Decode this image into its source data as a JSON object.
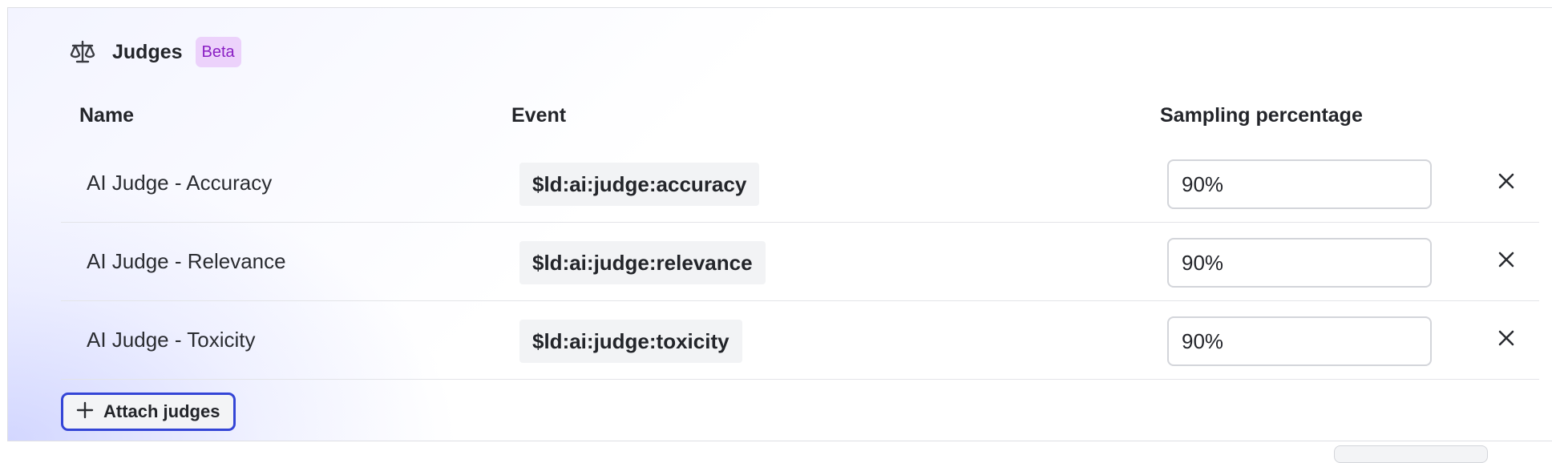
{
  "section": {
    "title": "Judges",
    "badge": "Beta",
    "icon": "scale-icon"
  },
  "table": {
    "columns": {
      "name": "Name",
      "event": "Event",
      "sampling": "Sampling percentage"
    },
    "rows": [
      {
        "name": "AI Judge - Accuracy",
        "event": "$ld:ai:judge:accuracy",
        "sampling": "90%"
      },
      {
        "name": "AI Judge - Relevance",
        "event": "$ld:ai:judge:relevance",
        "sampling": "90%"
      },
      {
        "name": "AI Judge - Toxicity",
        "event": "$ld:ai:judge:toxicity",
        "sampling": "90%"
      }
    ]
  },
  "actions": {
    "attach_label": "Attach judges"
  },
  "colors": {
    "accent": "#3445d6",
    "badge_bg": "#ecd2fb",
    "badge_text": "#8a1fc4"
  }
}
